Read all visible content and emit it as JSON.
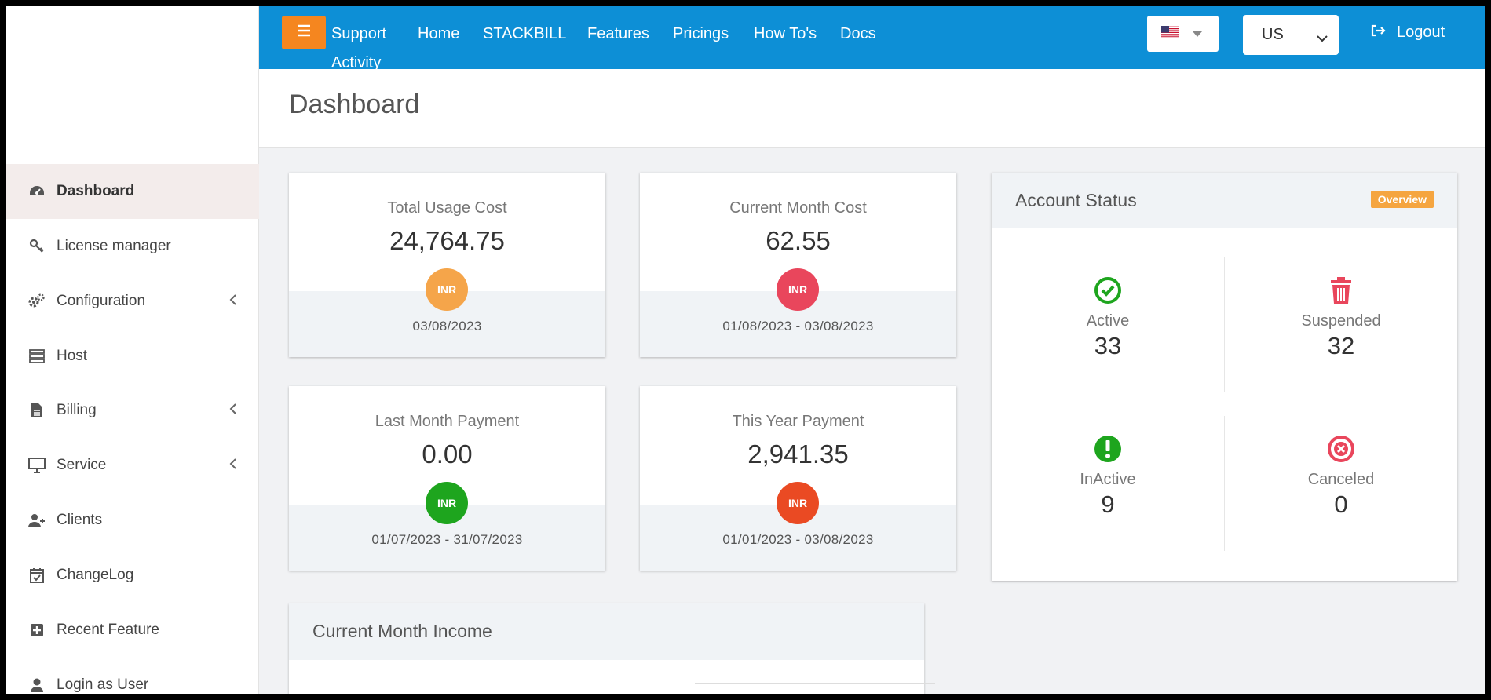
{
  "sidebar": {
    "items": [
      {
        "label": "Dashboard",
        "icon": "dashboard-icon"
      },
      {
        "label": "License manager",
        "icon": "key-icon"
      },
      {
        "label": "Configuration",
        "icon": "gears-icon"
      },
      {
        "label": "Host",
        "icon": "server-icon"
      },
      {
        "label": "Billing",
        "icon": "document-icon"
      },
      {
        "label": "Service",
        "icon": "monitor-icon"
      },
      {
        "label": "Clients",
        "icon": "user-plus-icon"
      },
      {
        "label": "ChangeLog",
        "icon": "calendar-check-icon"
      },
      {
        "label": "Recent Feature",
        "icon": "plus-square-icon"
      },
      {
        "label": "Login as User",
        "icon": "user-icon"
      }
    ]
  },
  "topbar": {
    "nav": [
      "Support",
      "Home",
      "STACKBILL",
      "Features",
      "Pricings",
      "How To's",
      "Docs",
      "Activity"
    ],
    "language_value": "US",
    "logout_label": "Logout"
  },
  "page": {
    "title": "Dashboard"
  },
  "cards": [
    {
      "caption": "Total Usage Cost",
      "value": "24,764.75",
      "currency": "INR",
      "date": "03/08/2023",
      "color": "#f5a54a"
    },
    {
      "caption": "Current Month Cost",
      "value": "62.55",
      "currency": "INR",
      "date": "01/08/2023 - 03/08/2023",
      "color": "#e9465c"
    },
    {
      "caption": "Last Month Payment",
      "value": "0.00",
      "currency": "INR",
      "date": "01/07/2023 - 31/07/2023",
      "color": "#1ea51e"
    },
    {
      "caption": "This Year Payment",
      "value": "2,941.35",
      "currency": "INR",
      "date": "01/01/2023 - 03/08/2023",
      "color": "#ea4a23"
    }
  ],
  "account_status": {
    "title": "Account Status",
    "badge": "Overview",
    "stats": [
      {
        "label": "Active",
        "value": "33",
        "icon": "check-circle-icon",
        "color": "#1ea51e"
      },
      {
        "label": "Suspended",
        "value": "32",
        "icon": "trash-icon",
        "color": "#e9465c"
      },
      {
        "label": "InActive",
        "value": "9",
        "icon": "exclamation-circle-icon",
        "color": "#1ea51e"
      },
      {
        "label": "Canceled",
        "value": "0",
        "icon": "times-circle-icon",
        "color": "#e9465c"
      }
    ]
  },
  "income": {
    "title": "Current Month Income"
  },
  "colors": {
    "topbar": "#0d8fd6",
    "accent": "#f5861f"
  }
}
